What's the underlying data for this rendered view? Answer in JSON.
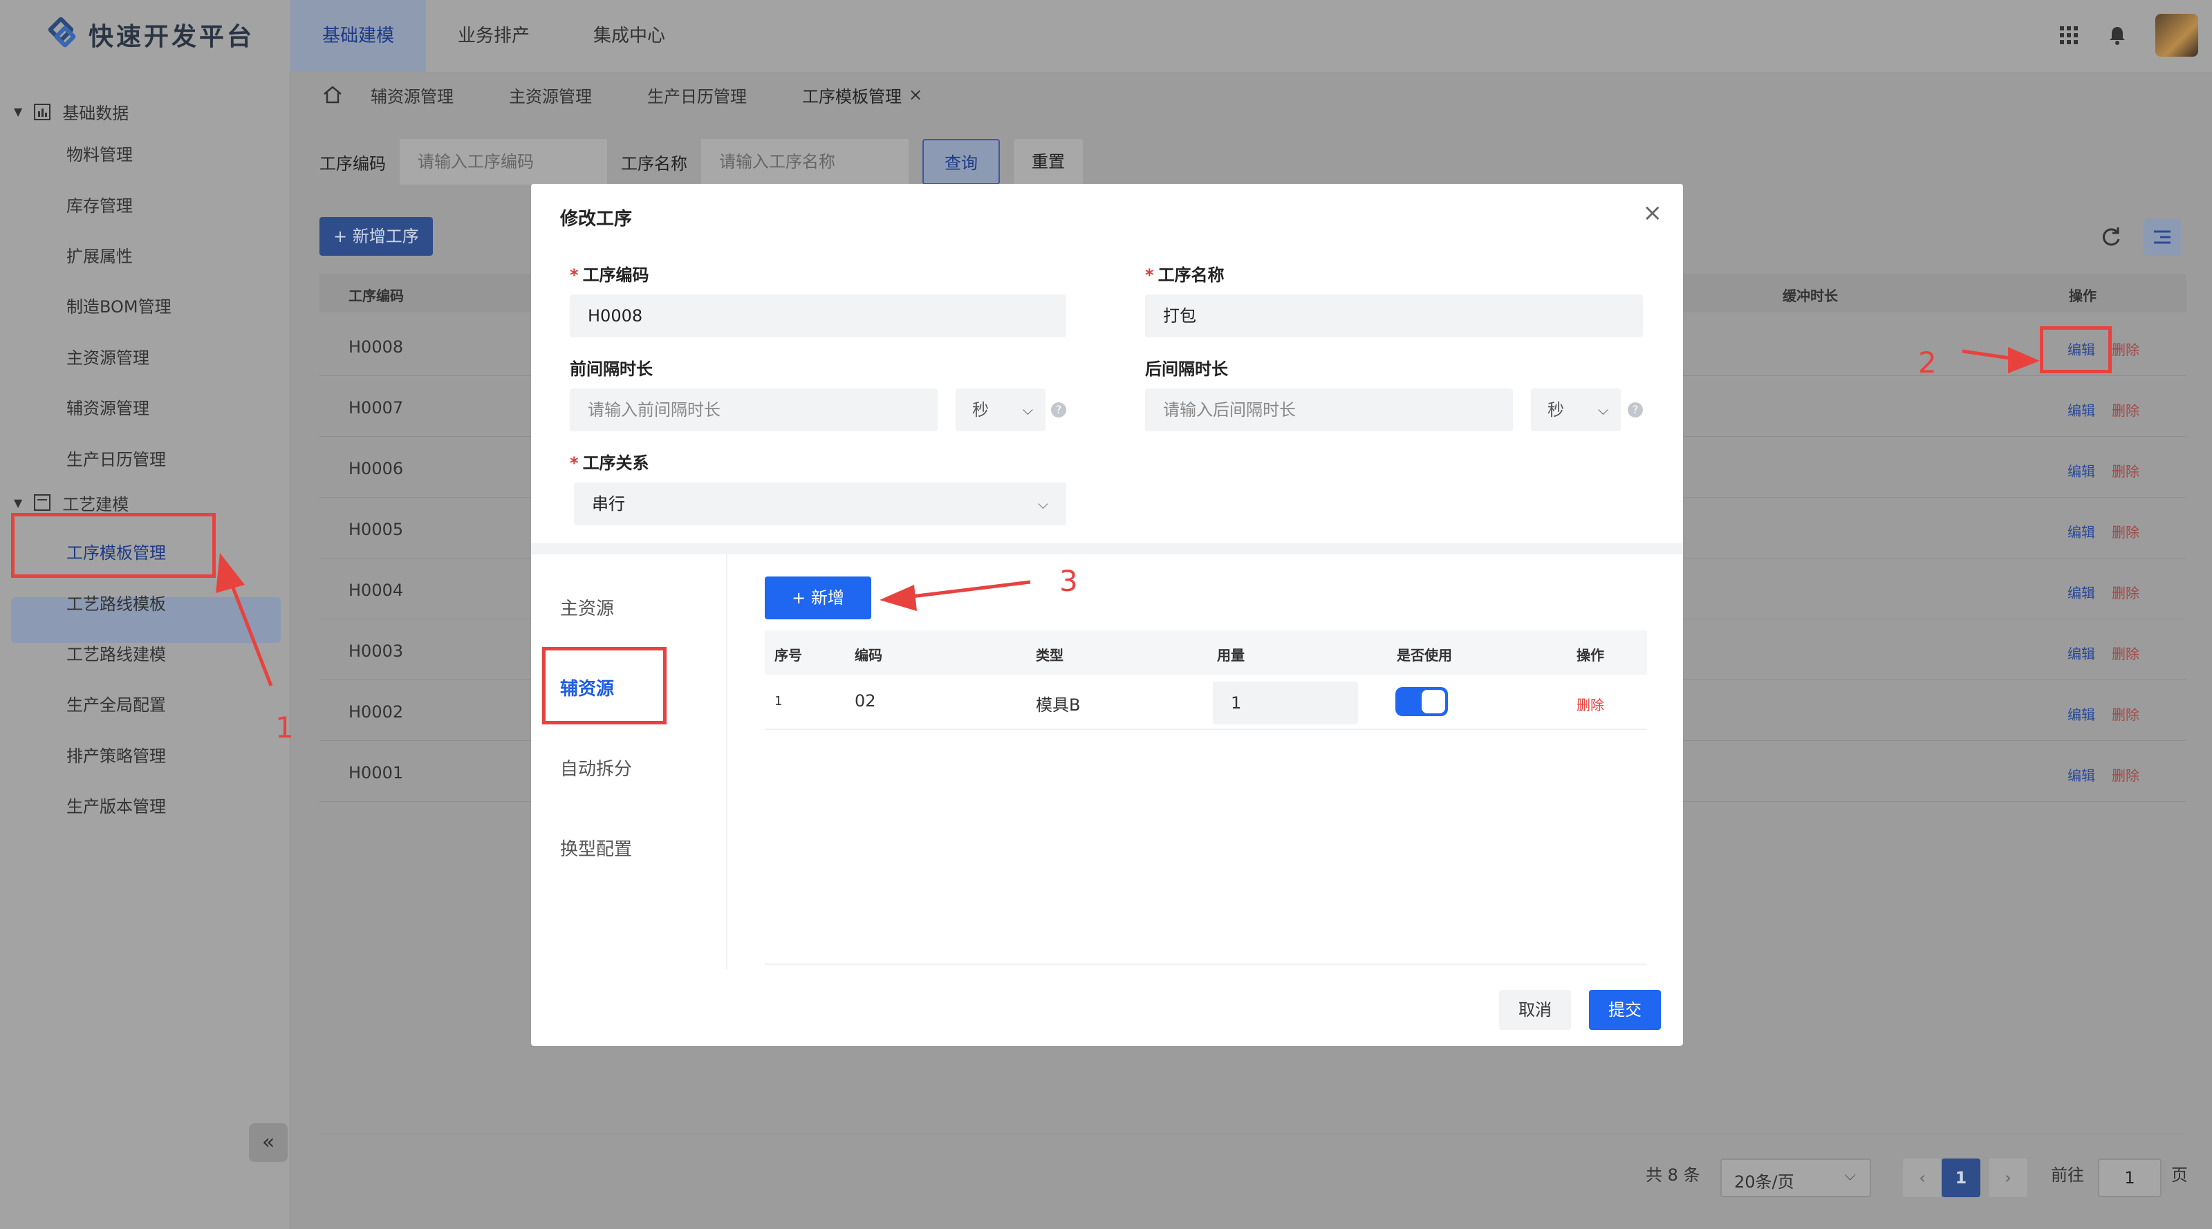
{
  "header": {
    "app_title": "快速开发平台",
    "nav": [
      "基础建模",
      "业务排产",
      "集成中心"
    ],
    "active_nav": "基础建模"
  },
  "sidebar": {
    "group1": "基础数据",
    "items1": [
      "物料管理",
      "库存管理",
      "扩展属性",
      "制造BOM管理",
      "主资源管理",
      "辅资源管理",
      "生产日历管理"
    ],
    "group2": "工艺建模",
    "items2": [
      "工序模板管理",
      "工艺路线模板",
      "工艺路线建模",
      "生产全局配置",
      "排产策略管理",
      "生产版本管理"
    ],
    "collapse": "«"
  },
  "tabs": [
    "辅资源管理",
    "主资源管理",
    "生产日历管理",
    "工序模板管理"
  ],
  "tab_close": "×",
  "search": {
    "code_label": "工序编码",
    "code_placeholder": "请输入工序编码",
    "name_label": "工序名称",
    "name_placeholder": "请输入工序名称",
    "query": "查询",
    "reset": "重置"
  },
  "list": {
    "new_button": "+ 新增工序",
    "col_code": "工序编码",
    "col_buffer": "缓冲时长",
    "col_op": "操作",
    "edit": "编辑",
    "delete": "删除",
    "rows": [
      "H0008",
      "H0007",
      "H0006",
      "H0005",
      "H0004",
      "H0003",
      "H0002",
      "H0001"
    ]
  },
  "pagination": {
    "total": "共 8 条",
    "page_size": "20条/页",
    "current_page": "1",
    "goto_label": "前往",
    "goto_value": "1",
    "page_suffix": "页"
  },
  "modal": {
    "title": "修改工序",
    "close": "×",
    "code_label": "工序编码",
    "code_value": "H0008",
    "name_label": "工序名称",
    "name_value": "打包",
    "pre_label": "前间隔时长",
    "pre_placeholder": "请输入前间隔时长",
    "post_label": "后间隔时长",
    "post_placeholder": "请输入后间隔时长",
    "unit": "秒",
    "relation_label": "工序关系",
    "relation_value": "串行",
    "side_tabs": [
      "主资源",
      "辅资源",
      "自动拆分",
      "换型配置"
    ],
    "active_side_tab": "辅资源",
    "add_button": "+ 新增",
    "sub_cols": [
      "序号",
      "编码",
      "类型",
      "用量",
      "是否使用",
      "操作"
    ],
    "sub_row": {
      "index": "1",
      "code": "02",
      "type": "模具B",
      "qty": "1",
      "enabled": true,
      "op": "删除"
    },
    "cancel": "取消",
    "submit": "提交"
  },
  "annotations": {
    "n1": "1",
    "n2": "2",
    "n3": "3"
  },
  "colors": {
    "primary": "#1f66f0",
    "danger": "#e8423f",
    "overlay": "#9c9c9c"
  }
}
